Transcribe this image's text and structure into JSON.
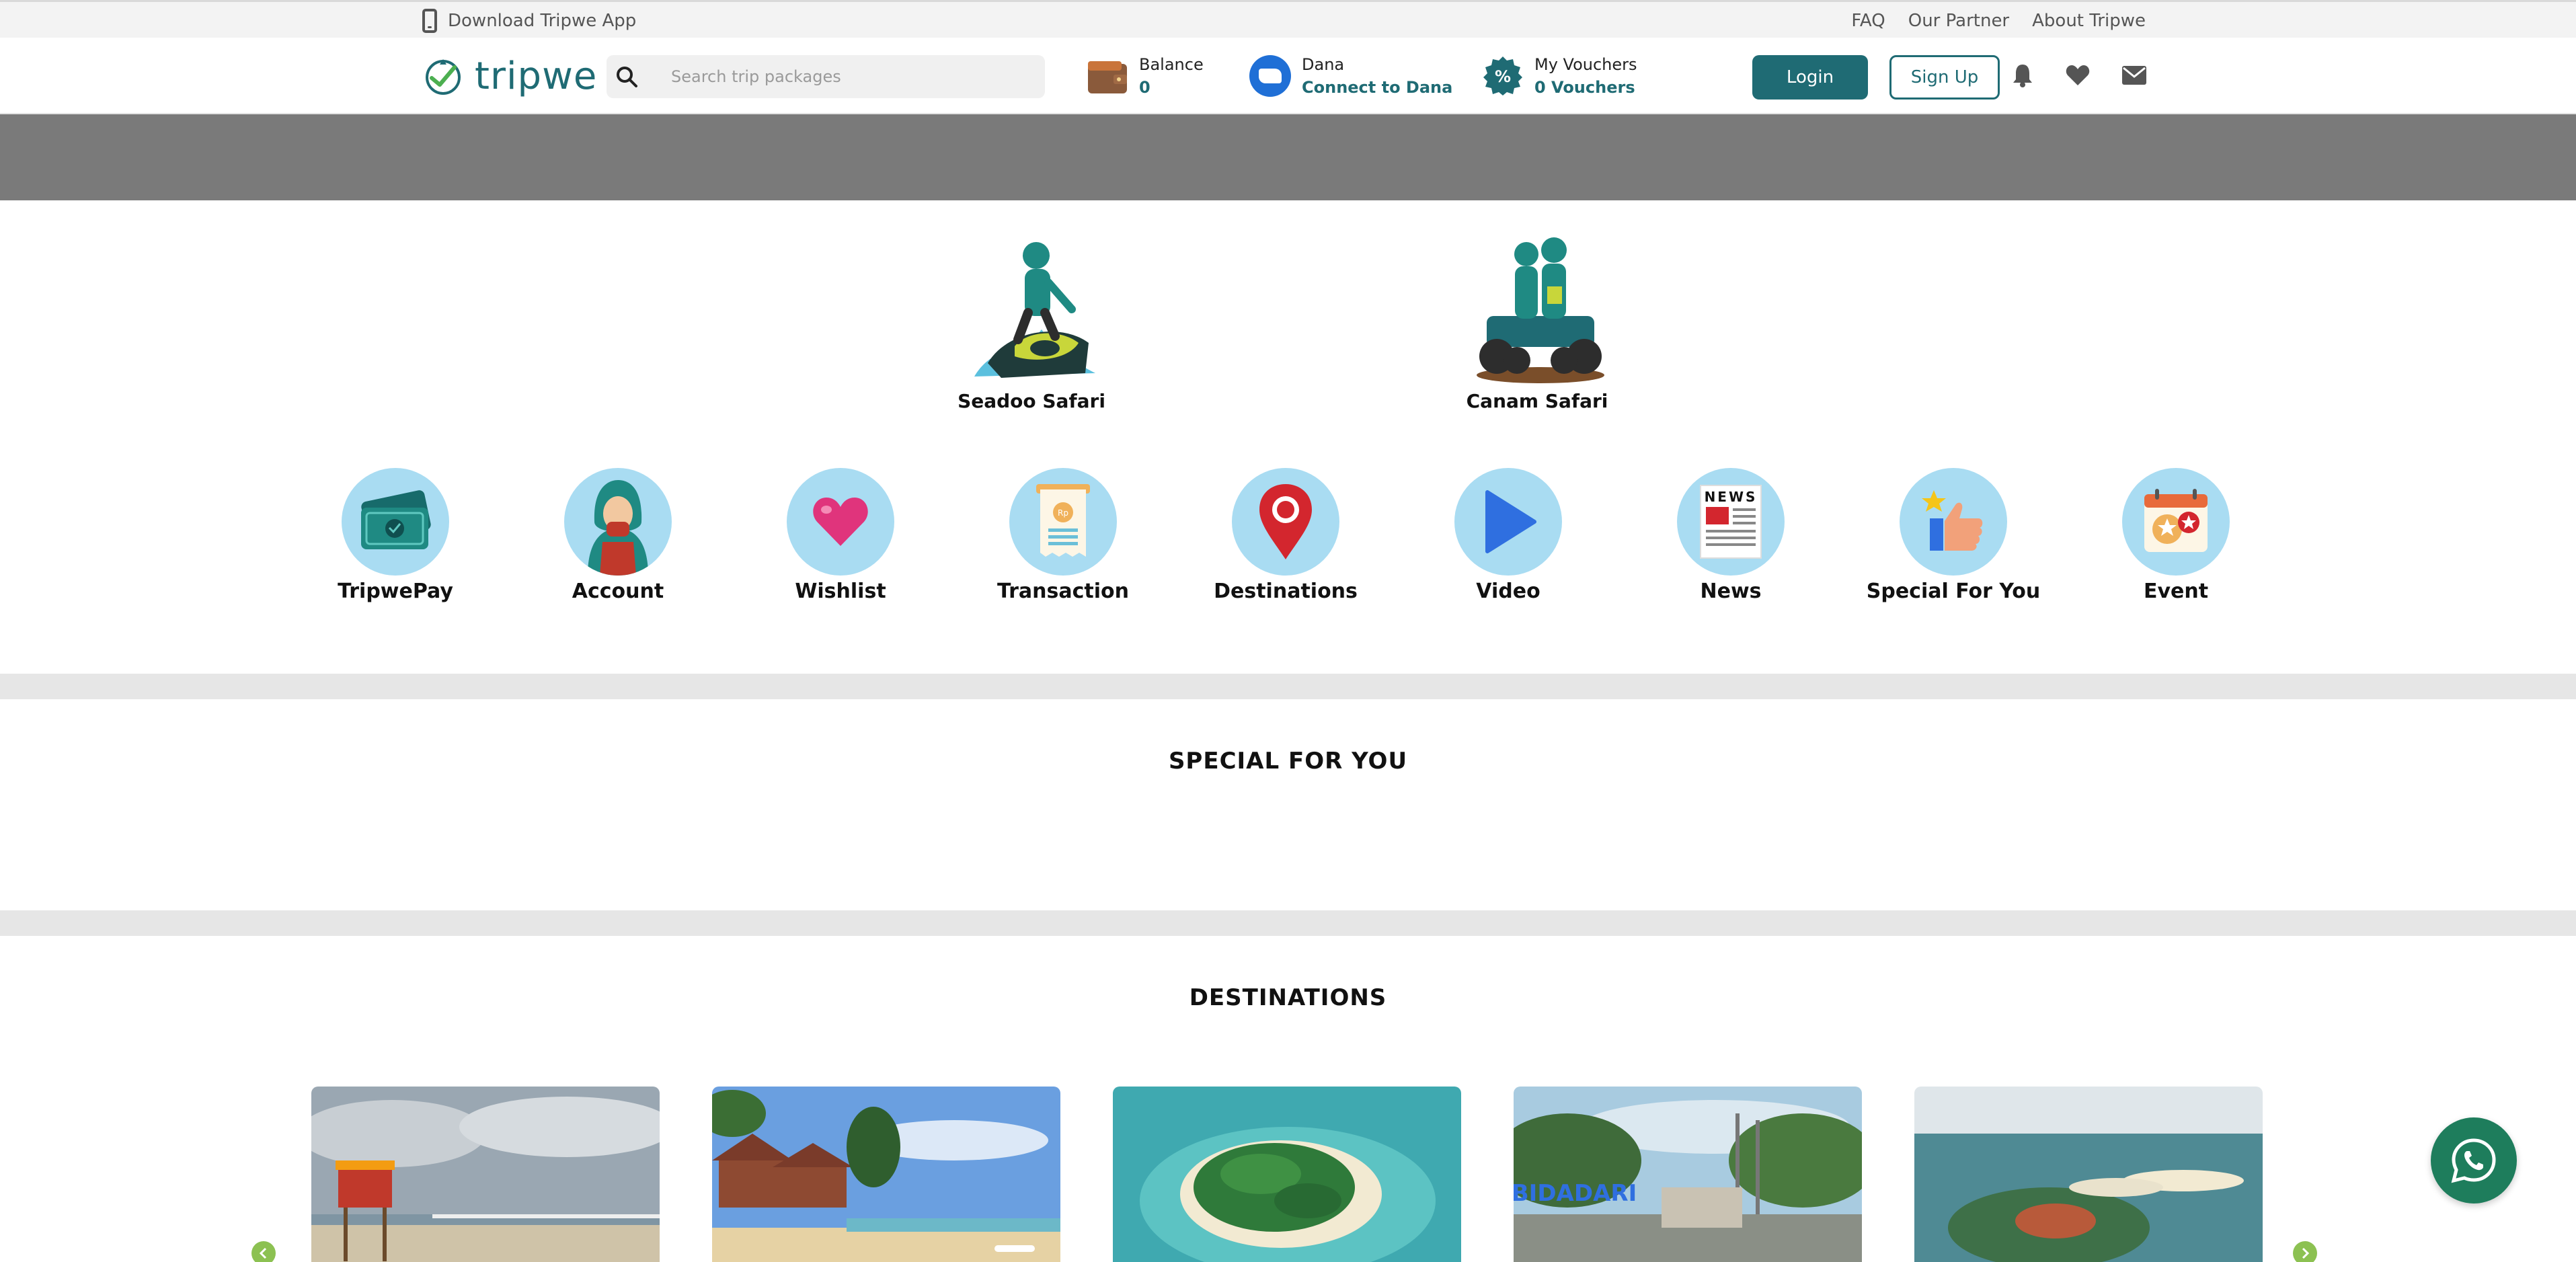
{
  "topbar": {
    "download_label": "Download Tripwe App",
    "links": [
      "FAQ",
      "Our Partner",
      "About Tripwe"
    ]
  },
  "header": {
    "logo_text": "tripwe",
    "search_placeholder": "Search trip packages",
    "balance": {
      "label": "Balance",
      "value": "0"
    },
    "dana": {
      "label": "Dana",
      "value": "Connect to Dana"
    },
    "vouchers": {
      "label": "My Vouchers",
      "value": "0 Vouchers"
    },
    "login_label": "Login",
    "signup_label": "Sign Up"
  },
  "featured": [
    {
      "label": "Seadoo Safari",
      "icon": "jetski-rider-icon"
    },
    {
      "label": "Canam Safari",
      "icon": "atv-riders-icon"
    }
  ],
  "menu": [
    {
      "label": "TripwePay",
      "icon": "wallet-cards-icon"
    },
    {
      "label": "Account",
      "icon": "user-avatar-icon"
    },
    {
      "label": "Wishlist",
      "icon": "heart-icon"
    },
    {
      "label": "Transaction",
      "icon": "receipt-icon"
    },
    {
      "label": "Destinations",
      "icon": "map-pin-icon"
    },
    {
      "label": "Video",
      "icon": "play-icon"
    },
    {
      "label": "News",
      "icon": "newspaper-icon",
      "badge": "NEWS"
    },
    {
      "label": "Special For You",
      "icon": "thumbs-up-star-icon"
    },
    {
      "label": "Event",
      "icon": "calendar-star-icon"
    }
  ],
  "sections": {
    "special": "SPECIAL FOR YOU",
    "destinations": "DESTINATIONS"
  },
  "destination_cards": [
    {
      "image": "beach-lifeguard-tower-photo"
    },
    {
      "image": "beach-huts-photo"
    },
    {
      "image": "tropical-island-aerial-photo"
    },
    {
      "image": "bidadari-island-photo",
      "sign_text": "BIDADARI"
    },
    {
      "image": "island-resort-aerial-photo"
    }
  ],
  "colors": {
    "brand": "#1f6b74",
    "icon_circle": "#a9dcf2",
    "banner": "#7a7a7a",
    "whatsapp": "#1e7d5c",
    "carousel_arrow": "#8cc152"
  }
}
